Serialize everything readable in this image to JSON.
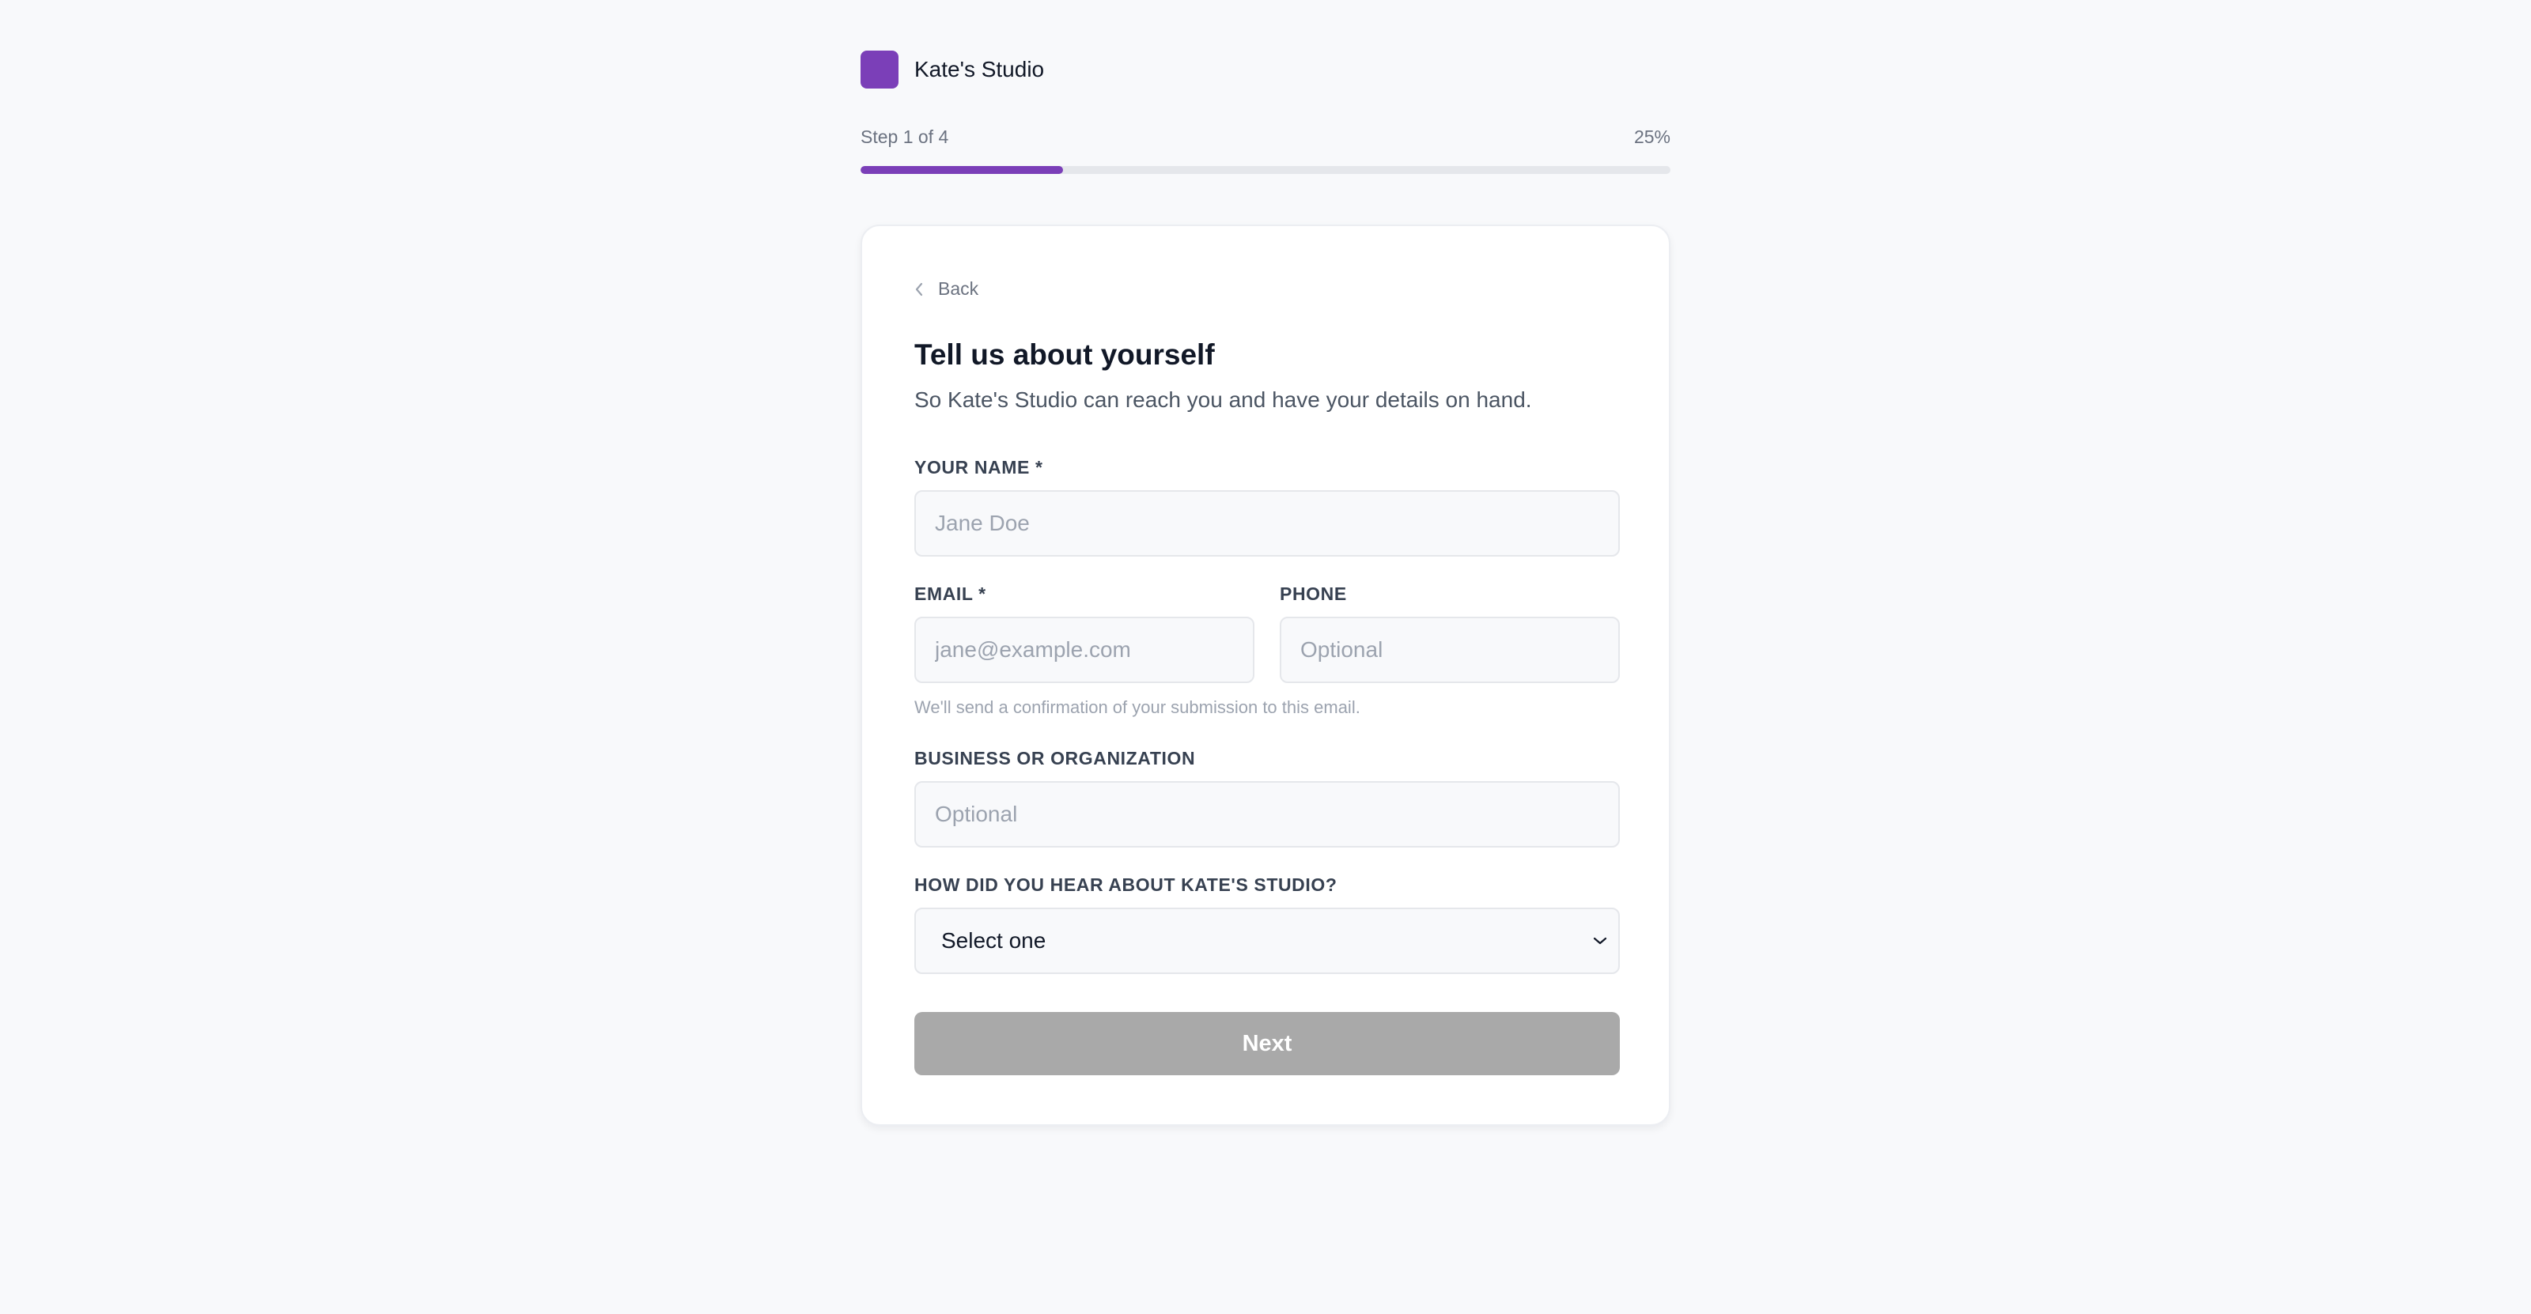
{
  "brand": {
    "name": "Kate's Studio",
    "color": "#7b3fb8"
  },
  "progress": {
    "step_text": "Step 1 of 4",
    "percent_text": "25%",
    "fraction": 0.25
  },
  "card": {
    "back_label": "Back",
    "back_icon": "chevron-left-icon",
    "title": "Tell us about yourself",
    "subtitle": "So Kate's Studio can reach you and have your details on hand."
  },
  "form": {
    "name": {
      "label": "YOUR NAME *",
      "placeholder": "Jane Doe",
      "value": ""
    },
    "email": {
      "label": "EMAIL *",
      "placeholder": "jane@example.com",
      "value": "",
      "hint": "We'll send a confirmation of your submission to this email."
    },
    "phone": {
      "label": "PHONE",
      "placeholder": "Optional",
      "value": ""
    },
    "business": {
      "label": "BUSINESS OR ORGANIZATION",
      "placeholder": "Optional",
      "value": ""
    },
    "referral": {
      "label": "HOW DID YOU HEAR ABOUT KATE'S STUDIO?",
      "selected": "Select one",
      "icon": "chevron-down-icon"
    },
    "next_label": "Next",
    "next_color": "#a9a9a9"
  }
}
